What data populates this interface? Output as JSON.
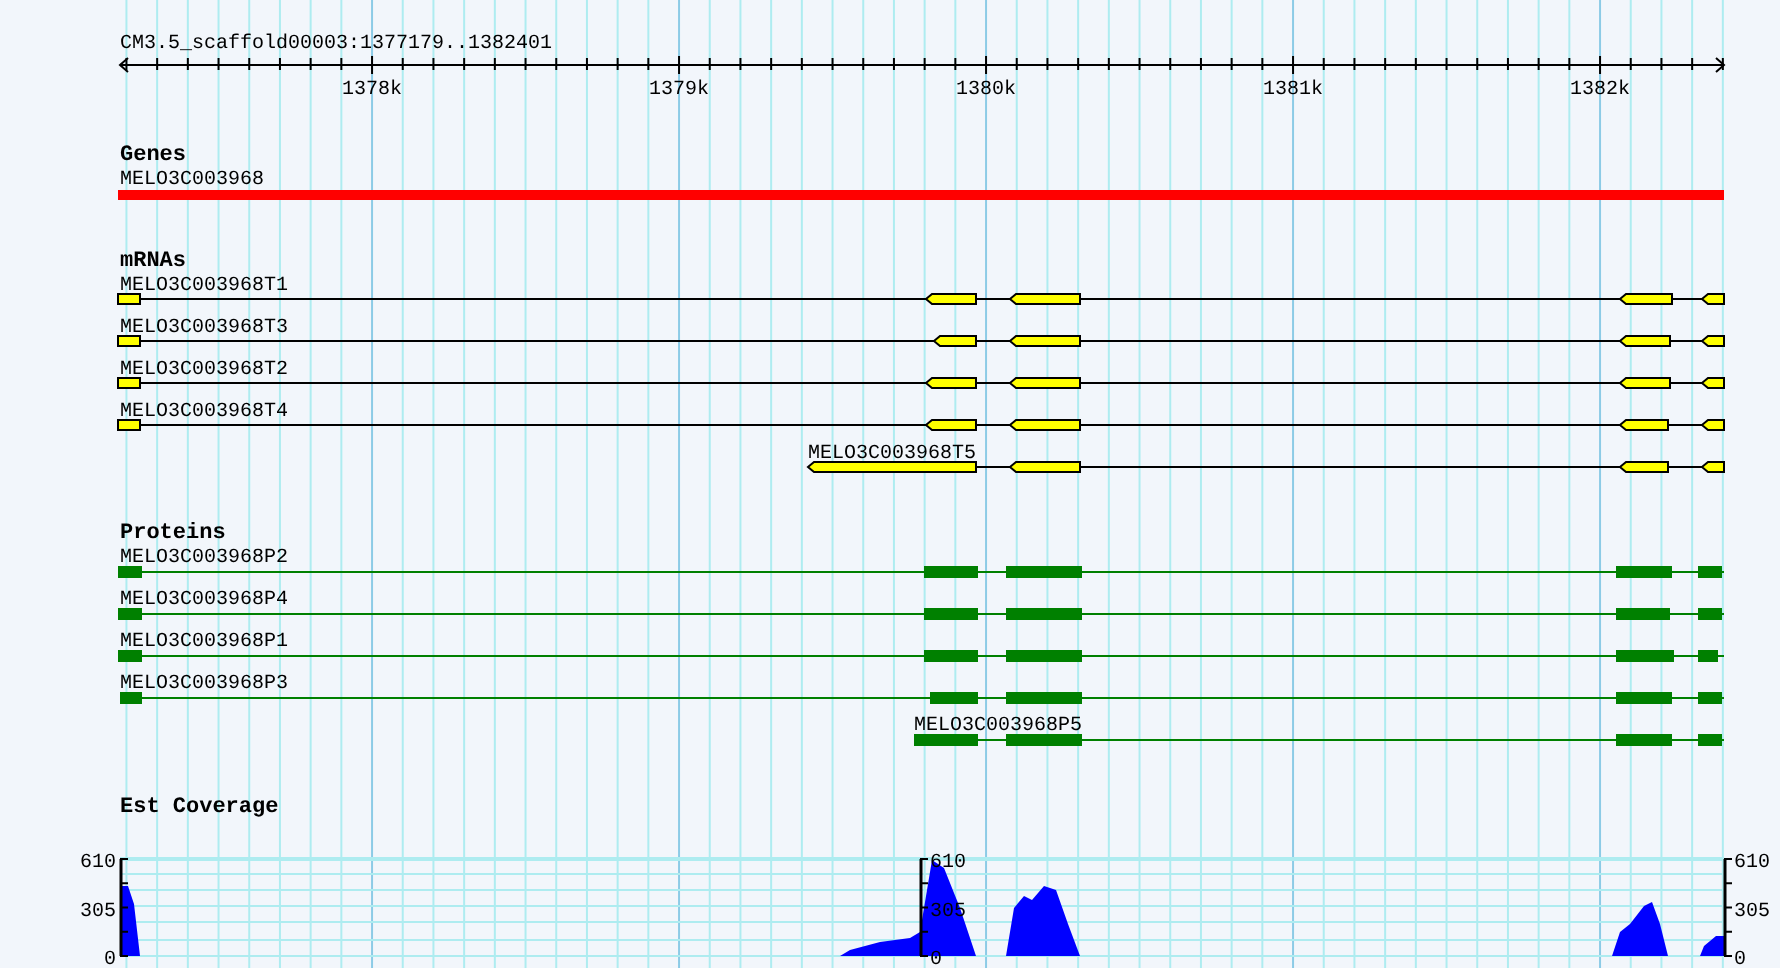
{
  "ruler": {
    "label": "CM3.5_scaffold00003:1377179..1382401",
    "ticks": [
      "1378k",
      "1379k",
      "1380k",
      "1381k",
      "1382k"
    ]
  },
  "tracks": [
    {
      "title": "Genes",
      "kind": "gene",
      "features": [
        {
          "label": "MELO3C003968"
        }
      ]
    },
    {
      "title": "mRNAs",
      "kind": "mrna",
      "features": [
        {
          "label": "MELO3C003968T1"
        },
        {
          "label": "MELO3C003968T3"
        },
        {
          "label": "MELO3C003968T2"
        },
        {
          "label": "MELO3C003968T4"
        },
        {
          "label": "MELO3C003968T5"
        }
      ]
    },
    {
      "title": "Proteins",
      "kind": "protein",
      "features": [
        {
          "label": "MELO3C003968P2"
        },
        {
          "label": "MELO3C003968P4"
        },
        {
          "label": "MELO3C003968P1"
        },
        {
          "label": "MELO3C003968P3"
        },
        {
          "label": "MELO3C003968P5"
        }
      ]
    }
  ],
  "coverage": {
    "title": "Est Coverage",
    "axes": [
      {
        "kind": "left",
        "labels": [
          "610",
          "305",
          "0"
        ]
      },
      {
        "kind": "right",
        "labels": [
          "610",
          "305",
          "0"
        ]
      },
      {
        "kind": "right",
        "labels": [
          "610",
          "305",
          "0"
        ]
      }
    ]
  }
}
